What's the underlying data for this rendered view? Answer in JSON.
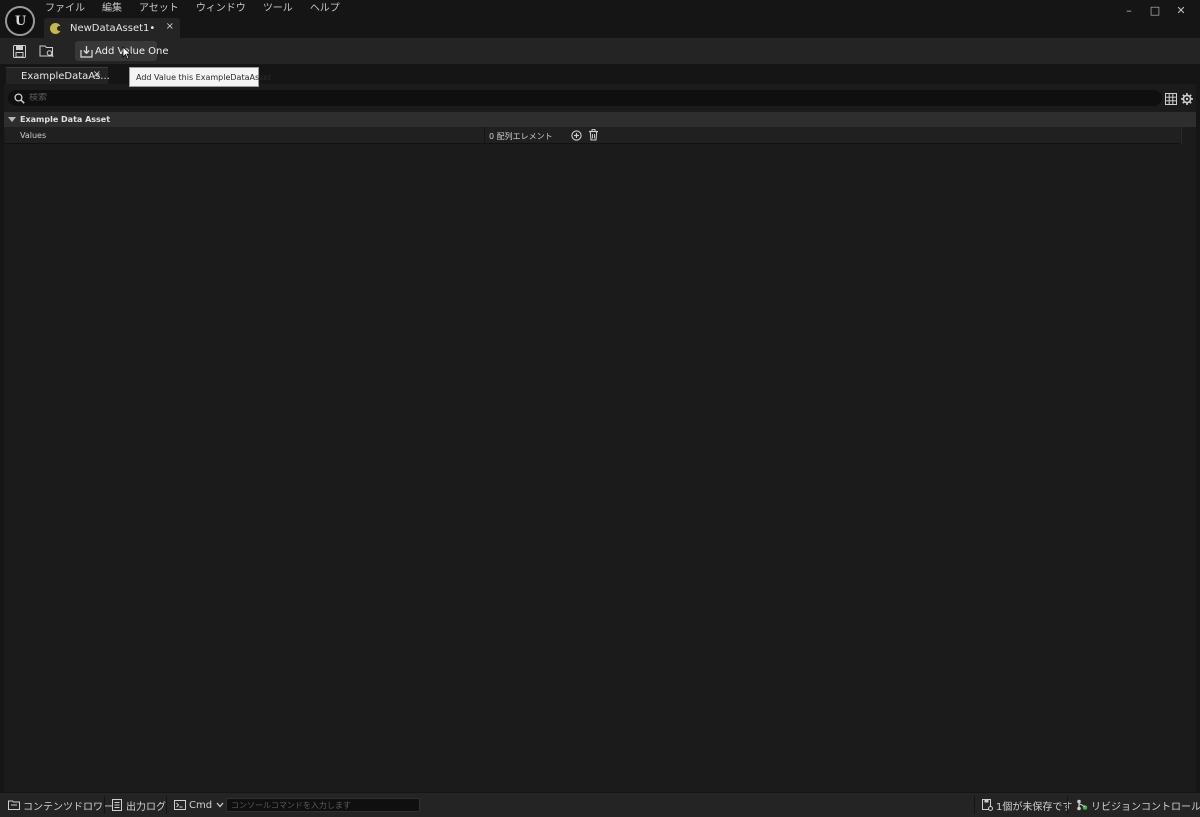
{
  "menubar": {
    "items": [
      "ファイル",
      "編集",
      "アセット",
      "ウィンドウ",
      "ツール",
      "ヘルプ"
    ]
  },
  "window_controls": {
    "minimize": "–",
    "maximize": "□",
    "close": "✕"
  },
  "document_tab": {
    "label": "NewDataAsset1•",
    "close": "×"
  },
  "toolbar": {
    "add_value_label": "Add Value One"
  },
  "tooltip": {
    "text": "Add Value this ExampleDataAsset"
  },
  "panel_tab": {
    "label": "ExampleDataAs...",
    "close": "×"
  },
  "details": {
    "search_placeholder": "検索",
    "category": "Example Data Asset",
    "property": {
      "name": "Values",
      "value": "0 配列エレメント"
    }
  },
  "statusbar": {
    "content_drawer": "コンテンツドロワー",
    "output_log": "出力ログ",
    "cmd": "Cmd",
    "console_placeholder": "コンソールコマンドを入力します",
    "unsaved": "1個が未保存です",
    "revision_control": "リビジョンコントロール"
  },
  "colors": {
    "background": "#151515",
    "panel": "#1b1b1b",
    "toolbar": "#242424",
    "asset_icon": "#c8b84a",
    "revision_green": "#3cb44a"
  }
}
